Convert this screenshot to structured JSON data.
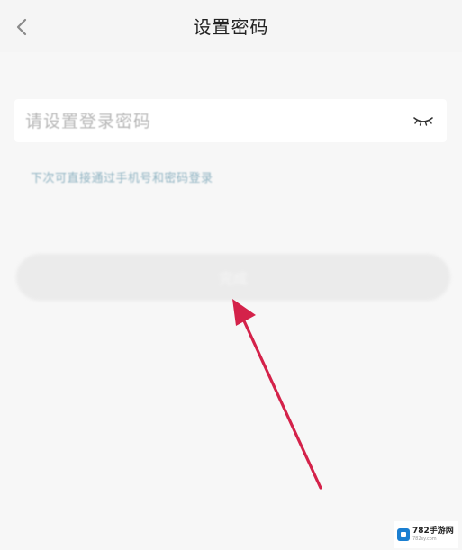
{
  "header": {
    "back_icon": "chevron-left-icon",
    "title": "设置密码"
  },
  "password": {
    "placeholder": "请设置登录密码",
    "value": "",
    "eye_icon": "eye-closed-icon"
  },
  "hint": "下次可直接通过手机号和密码登录",
  "submit": {
    "label": "完成"
  },
  "colors": {
    "annotation_arrow": "#d4224a",
    "hint": "#8fb3c2",
    "button_disabled": "#ebebeb"
  },
  "watermark": {
    "title": "782手游网",
    "subtitle": "782sy.com"
  }
}
